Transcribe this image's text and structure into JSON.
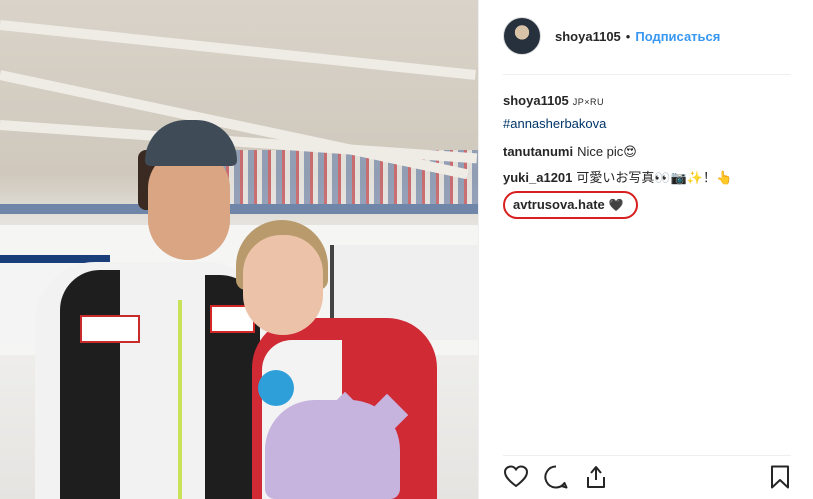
{
  "post": {
    "author": "shoya1105",
    "follow_label": "Подписаться",
    "dot": "•"
  },
  "caption": {
    "user": "shoya1105",
    "tag": "JP×RU",
    "hashtag": "#annasherbakova"
  },
  "comments": [
    {
      "user": "tanutanumi",
      "text": "Nice pic😍"
    },
    {
      "user": "yuki_a1201",
      "text": "可愛いお写真👀📷✨！👆"
    },
    {
      "user": "avtrusova.hate",
      "text": "🖤"
    }
  ],
  "actions": {
    "like_icon": "heart-icon",
    "comment_icon": "comment-icon",
    "share_icon": "share-icon",
    "save_icon": "bookmark-icon"
  },
  "colors": {
    "link_blue": "#3897f0",
    "hashtag": "#003569",
    "annotation_red": "#d81f1f"
  }
}
